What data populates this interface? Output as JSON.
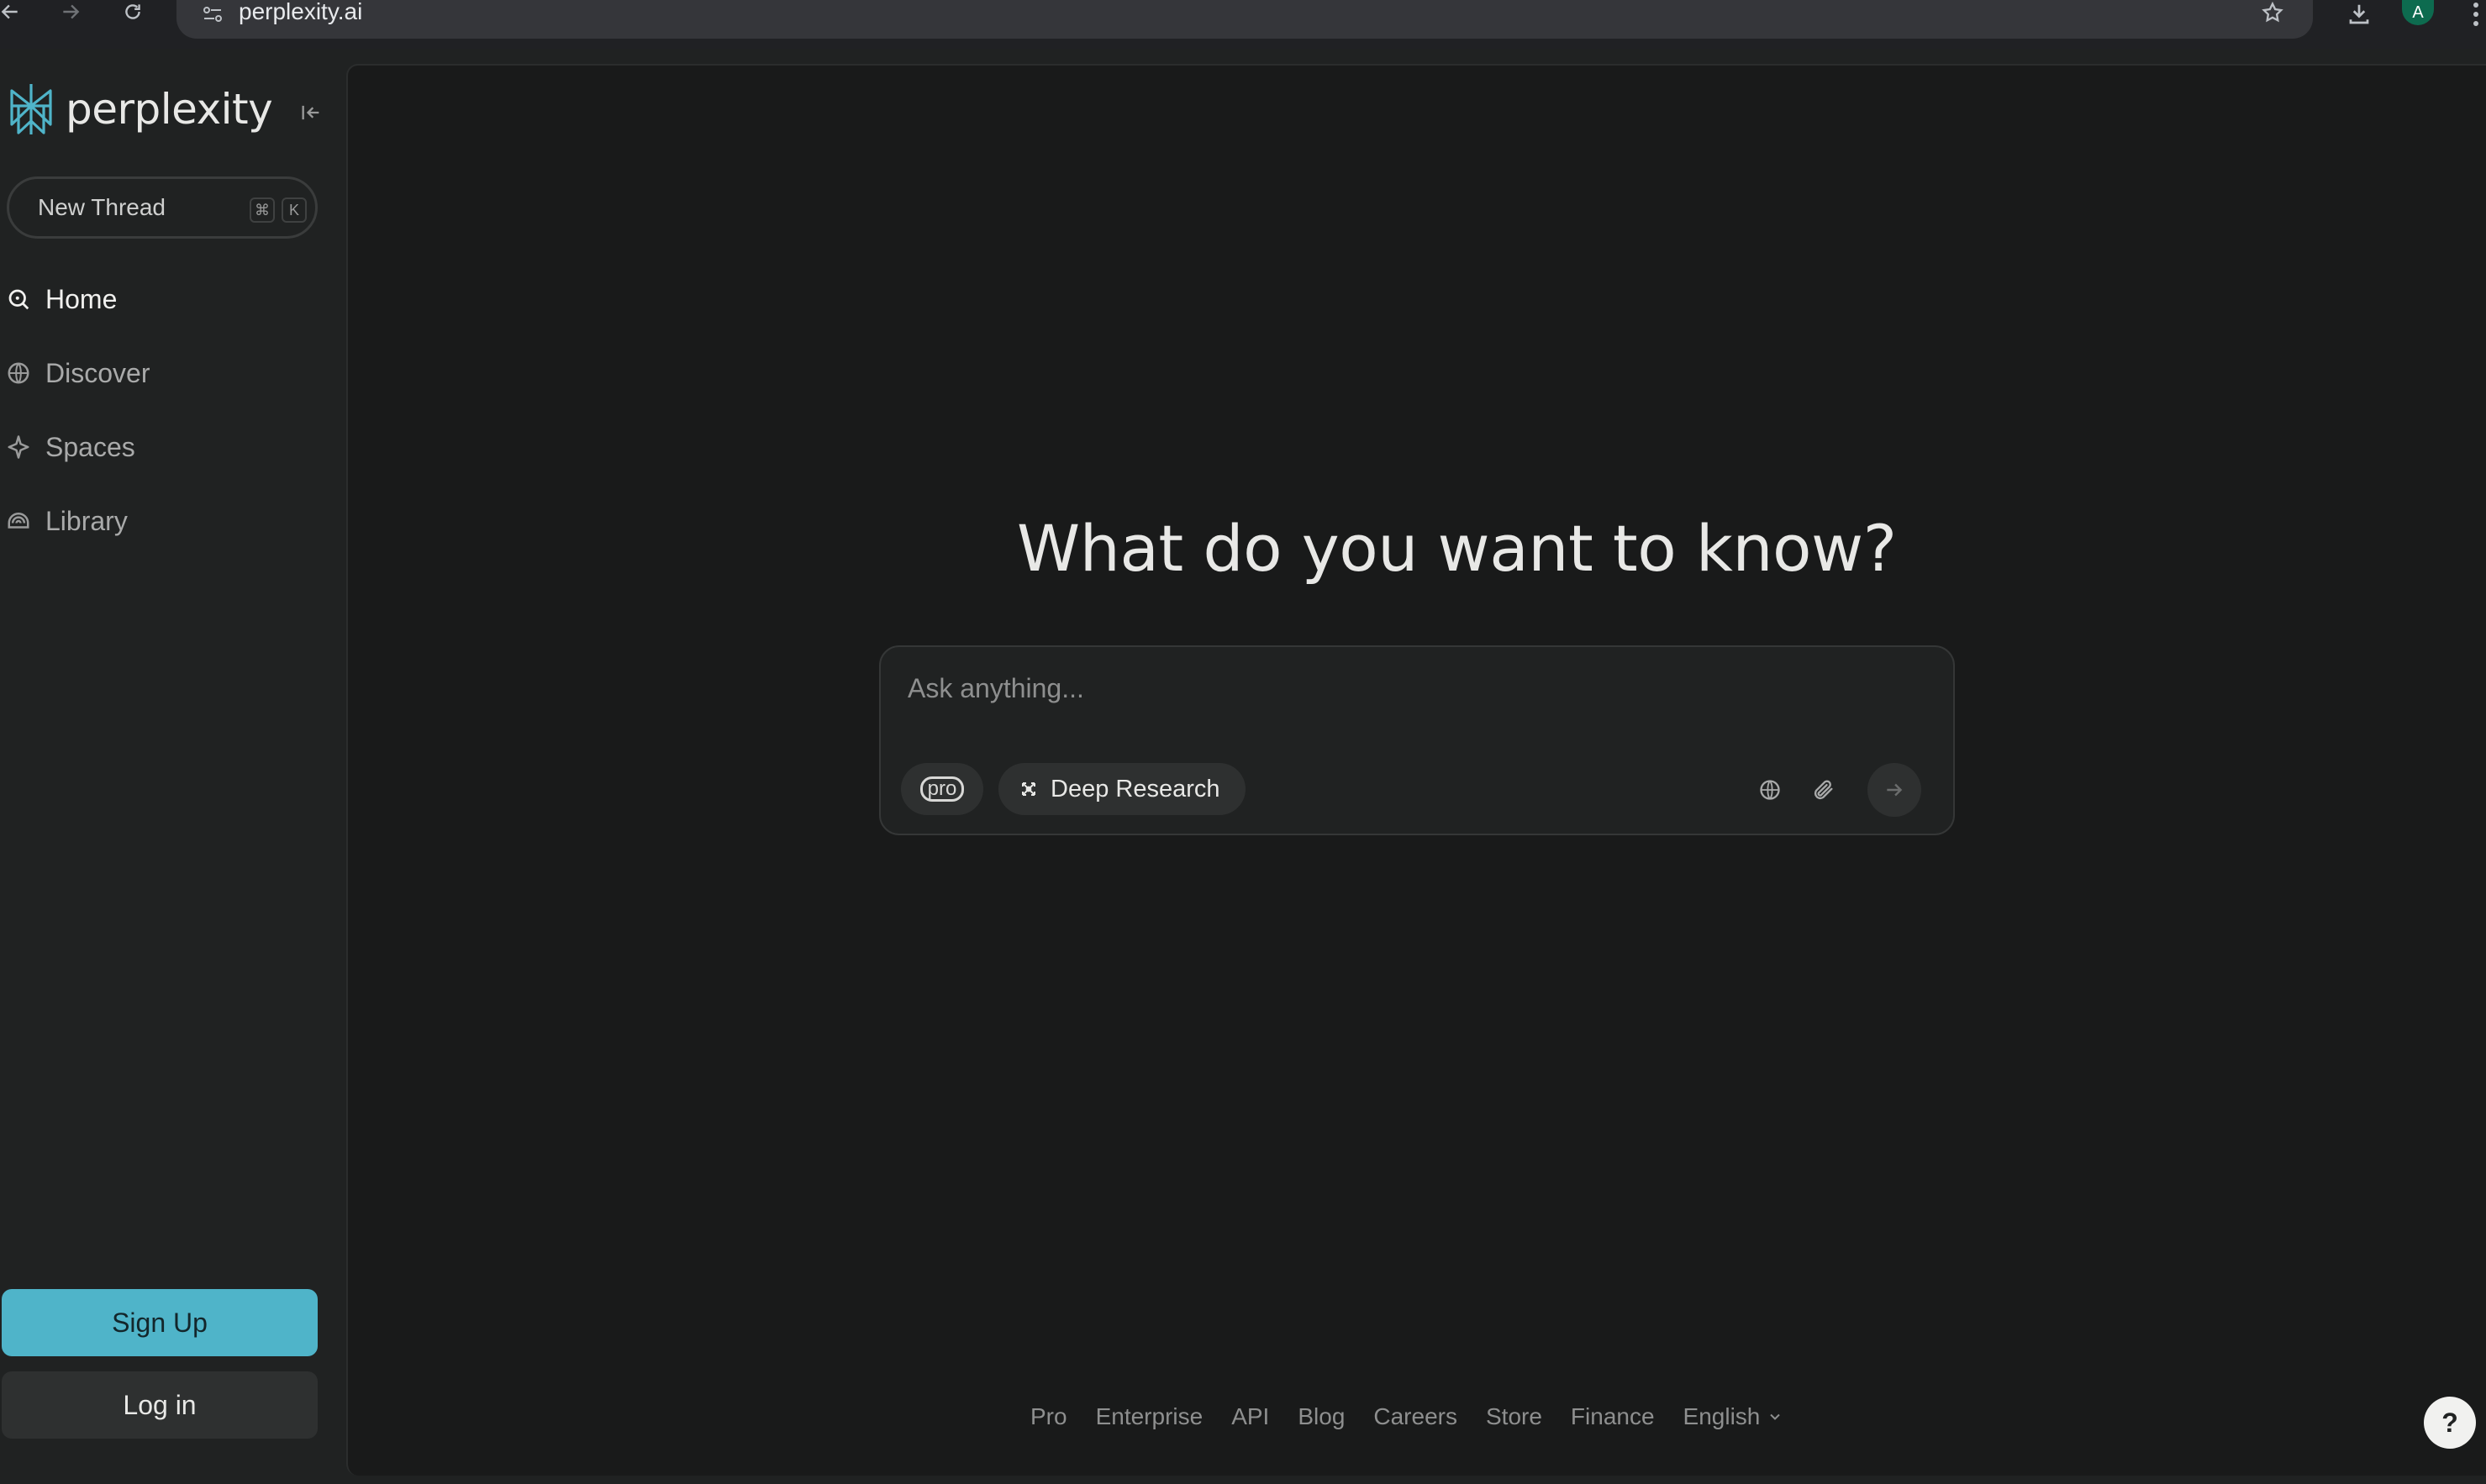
{
  "browser": {
    "url": "perplexity.ai",
    "avatar_letter": "A"
  },
  "sidebar": {
    "logo_text": "perplexity",
    "new_thread": {
      "label": "New Thread",
      "shortcut_keys": [
        "⌘",
        "K"
      ]
    },
    "nav_items": [
      {
        "label": "Home",
        "icon": "search-icon",
        "active": true
      },
      {
        "label": "Discover",
        "icon": "globe-icon",
        "active": false
      },
      {
        "label": "Spaces",
        "icon": "spaces-icon",
        "active": false
      },
      {
        "label": "Library",
        "icon": "library-icon",
        "active": false
      }
    ],
    "signup_label": "Sign Up",
    "login_label": "Log in"
  },
  "main": {
    "heading": "What do you want to know?",
    "ask": {
      "placeholder": "Ask anything...",
      "pro_label": "pro",
      "deep_research_label": "Deep Research"
    },
    "footer_links": [
      "Pro",
      "Enterprise",
      "API",
      "Blog",
      "Careers",
      "Store",
      "Finance"
    ],
    "language": "English",
    "help_label": "?"
  },
  "colors": {
    "accent": "#4fb4c9",
    "background": "#191a1a",
    "sidebar": "#202222"
  }
}
